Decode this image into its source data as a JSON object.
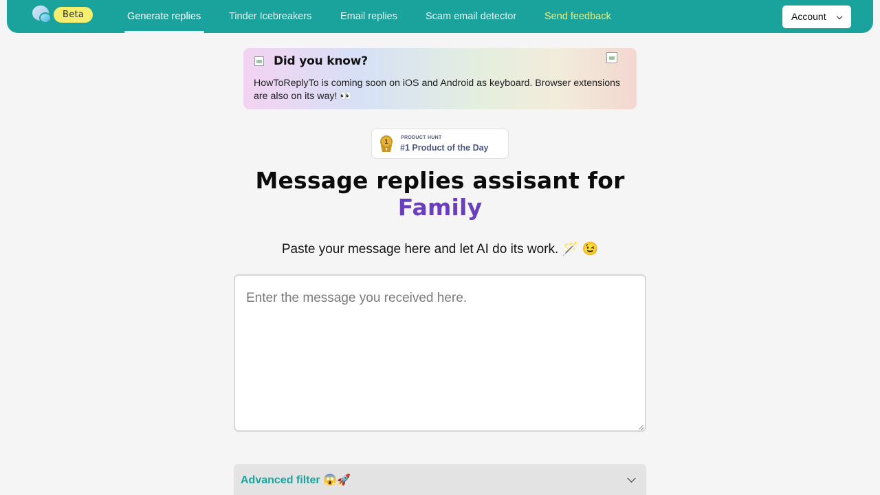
{
  "nav": {
    "beta": "Beta",
    "links": [
      {
        "label": "Generate replies",
        "active": true
      },
      {
        "label": "Tinder Icebreakers"
      },
      {
        "label": "Email replies"
      },
      {
        "label": "Scam email detector"
      },
      {
        "label": "Send feedback"
      }
    ],
    "account": "Account"
  },
  "notice": {
    "title": "Did you know?",
    "body": "HowToReplyTo is coming soon on iOS and Android as keyboard. Browser extensions are also on its way! 👀"
  },
  "badge": {
    "kicker": "PRODUCT HUNT",
    "title": "#1 Product of the Day",
    "medal_number": "1"
  },
  "hero": {
    "title": "Message replies assisant for",
    "highlight": "Family",
    "subtitle": "Paste your message here and let AI do its work. 🪄 😉"
  },
  "input": {
    "placeholder": "Enter the message you received here."
  },
  "advanced": {
    "label": "Advanced filter 😱🚀"
  },
  "colors": {
    "brand": "#1aa39c",
    "highlight": "#6a3fbf",
    "beta_bg": "#f6ee6c"
  }
}
